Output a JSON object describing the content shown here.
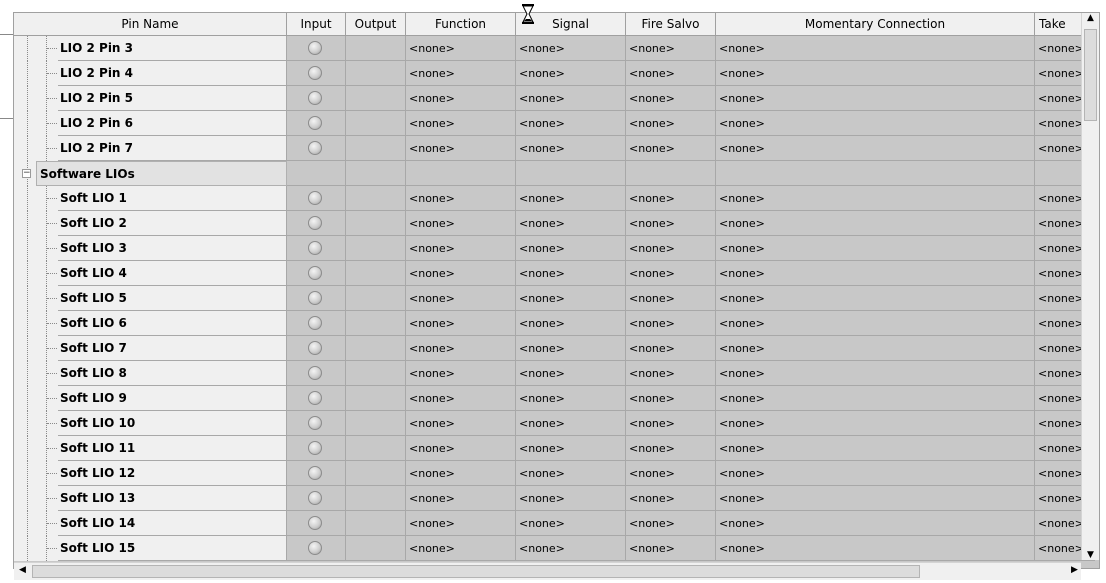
{
  "columns": [
    "Pin Name",
    "Input",
    "Output",
    "Function",
    "Signal",
    "Fire Salvo",
    "Momentary Connection",
    "Take"
  ],
  "none_value": "<none>",
  "truncated_none_value": "<none>",
  "top_rows": [
    {
      "label": "LIO 2 Pin 3"
    },
    {
      "label": "LIO 2 Pin 4"
    },
    {
      "label": "LIO 2 Pin 5"
    },
    {
      "label": "LIO 2 Pin 6"
    },
    {
      "label": "LIO 2 Pin 7"
    }
  ],
  "group": {
    "label": "Software LIOs",
    "expander": "−"
  },
  "soft_rows": [
    {
      "label": "Soft LIO 1"
    },
    {
      "label": "Soft LIO 2"
    },
    {
      "label": "Soft LIO 3"
    },
    {
      "label": "Soft LIO 4"
    },
    {
      "label": "Soft LIO 5"
    },
    {
      "label": "Soft LIO 6"
    },
    {
      "label": "Soft LIO 7"
    },
    {
      "label": "Soft LIO 8"
    },
    {
      "label": "Soft LIO 9"
    },
    {
      "label": "Soft LIO 10"
    },
    {
      "label": "Soft LIO 11"
    },
    {
      "label": "Soft LIO 12"
    },
    {
      "label": "Soft LIO 13"
    },
    {
      "label": "Soft LIO 14"
    },
    {
      "label": "Soft LIO 15"
    }
  ],
  "scroll": {
    "up": "▲",
    "down": "▼",
    "left": "◀",
    "right": "▶"
  },
  "icons": {
    "cursor": "hourglass-icon",
    "led": "led-indicator-icon"
  }
}
